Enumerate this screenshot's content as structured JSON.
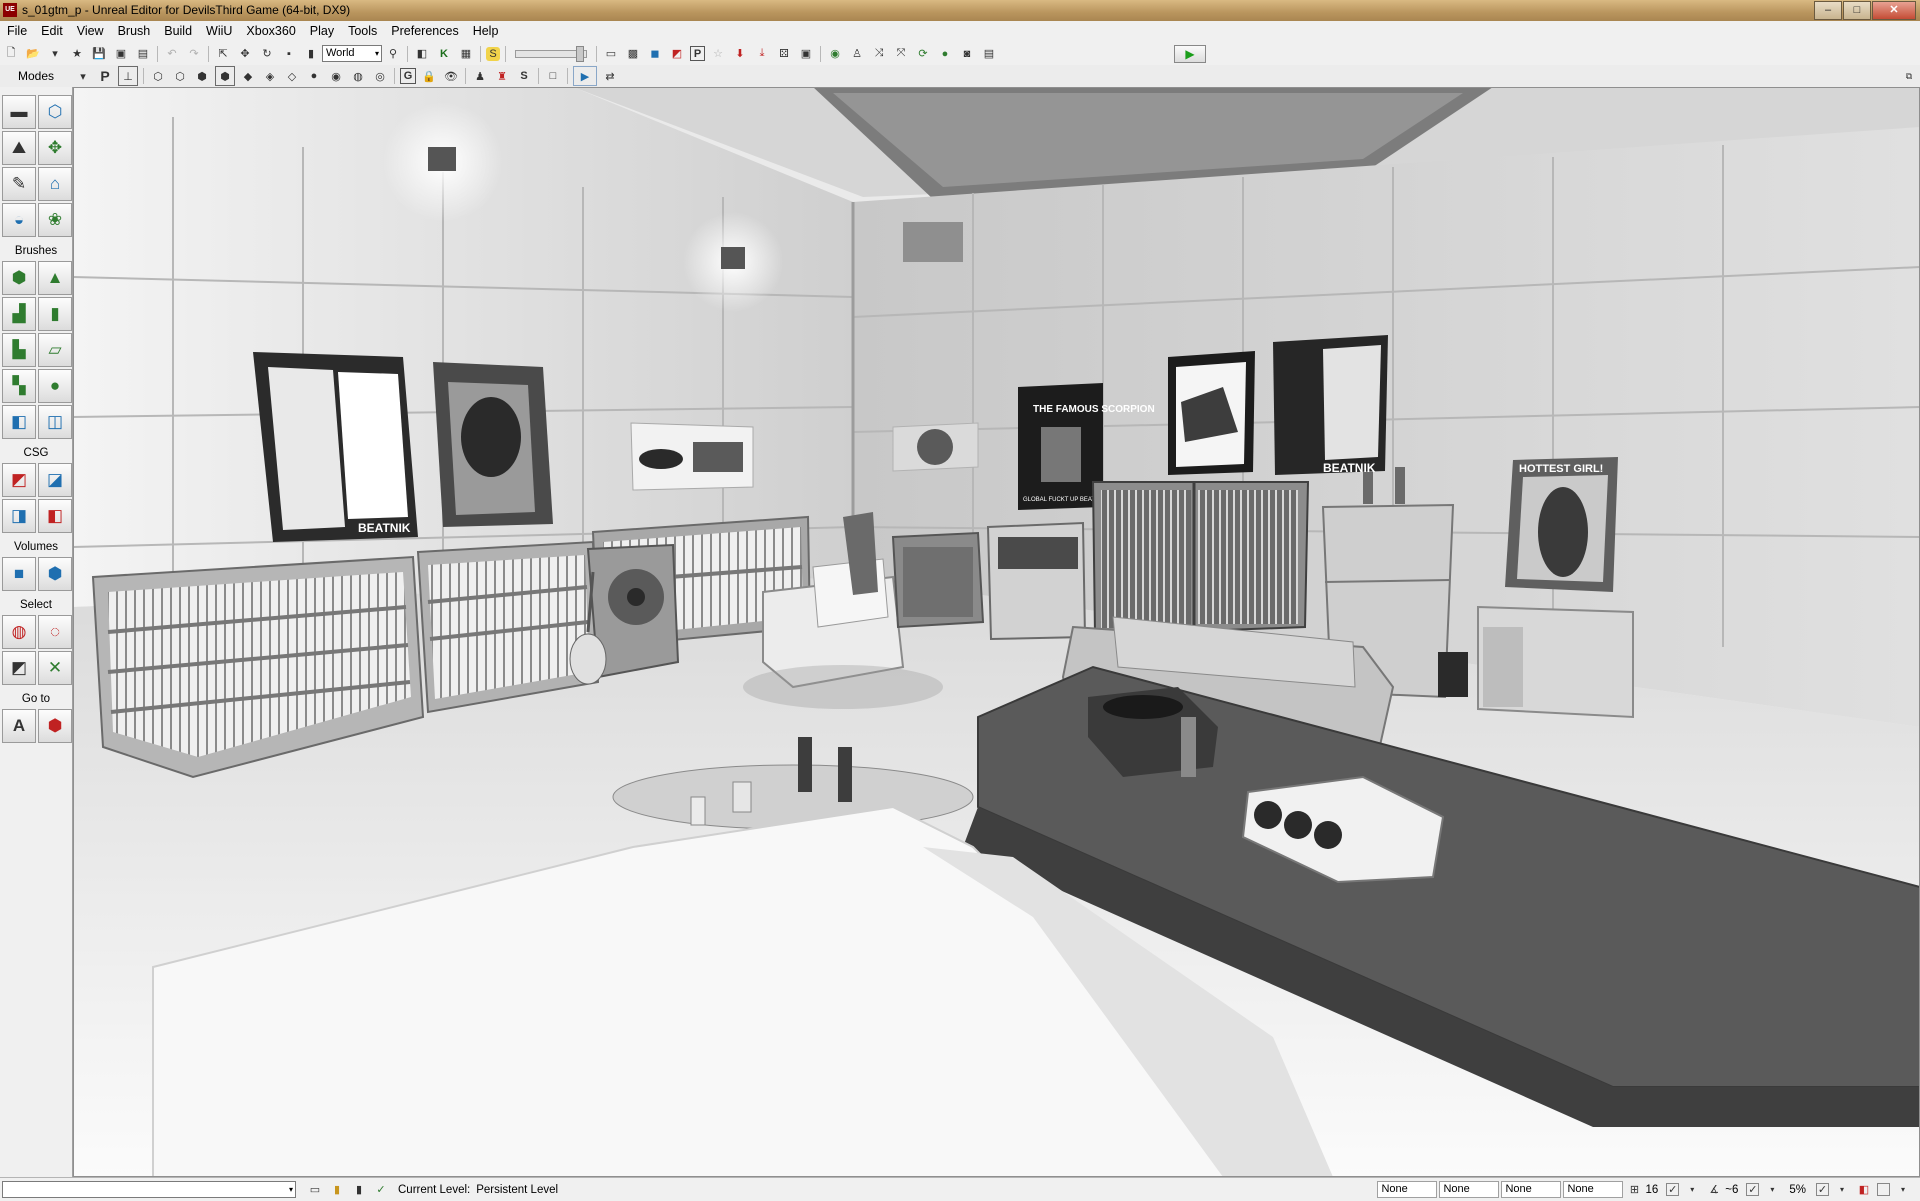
{
  "window": {
    "title": "s_01gtm_p - Unreal Editor for DevilsThird Game (64-bit, DX9)",
    "app_icon_text": "UE",
    "minimize": "–",
    "maximize": "□",
    "close": "✕"
  },
  "menu": [
    "File",
    "Edit",
    "View",
    "Brush",
    "Build",
    "WiiU",
    "Xbox360",
    "Play",
    "Tools",
    "Preferences",
    "Help"
  ],
  "toolbar": {
    "coord_system": "World",
    "coord_system_arrow": "▾",
    "p_label": "P",
    "k_label": "K",
    "s_label": "S",
    "g_label": "G",
    "play_symbol": "▶"
  },
  "modes_panel": {
    "title": "Modes",
    "sections": {
      "brushes": "Brushes",
      "csg": "CSG",
      "volumes": "Volumes",
      "select": "Select",
      "goto": "Go to"
    },
    "goto_a": "A"
  },
  "viewport": {
    "posters": {
      "p1_footer": "BEATNIK",
      "p5_title": "THE FAMOUS SCORPION",
      "p5_footer": "GLOBAL FUCKT UP BEATS",
      "p7_footer": "BEATNIK",
      "p8_title": "HOTTEST GIRL!"
    }
  },
  "statusbar": {
    "current_level_label": "Current Level:",
    "current_level_value": "Persistent Level",
    "fields": [
      "None",
      "None",
      "None",
      "None"
    ],
    "grid_value": "16",
    "rot_value": "~6",
    "zoom_value": "5%"
  },
  "colors": {
    "titlebar": "#c09c62",
    "chrome": "#f0f0f0",
    "play_green": "#1a9d1a",
    "close_red": "#c44c35"
  }
}
